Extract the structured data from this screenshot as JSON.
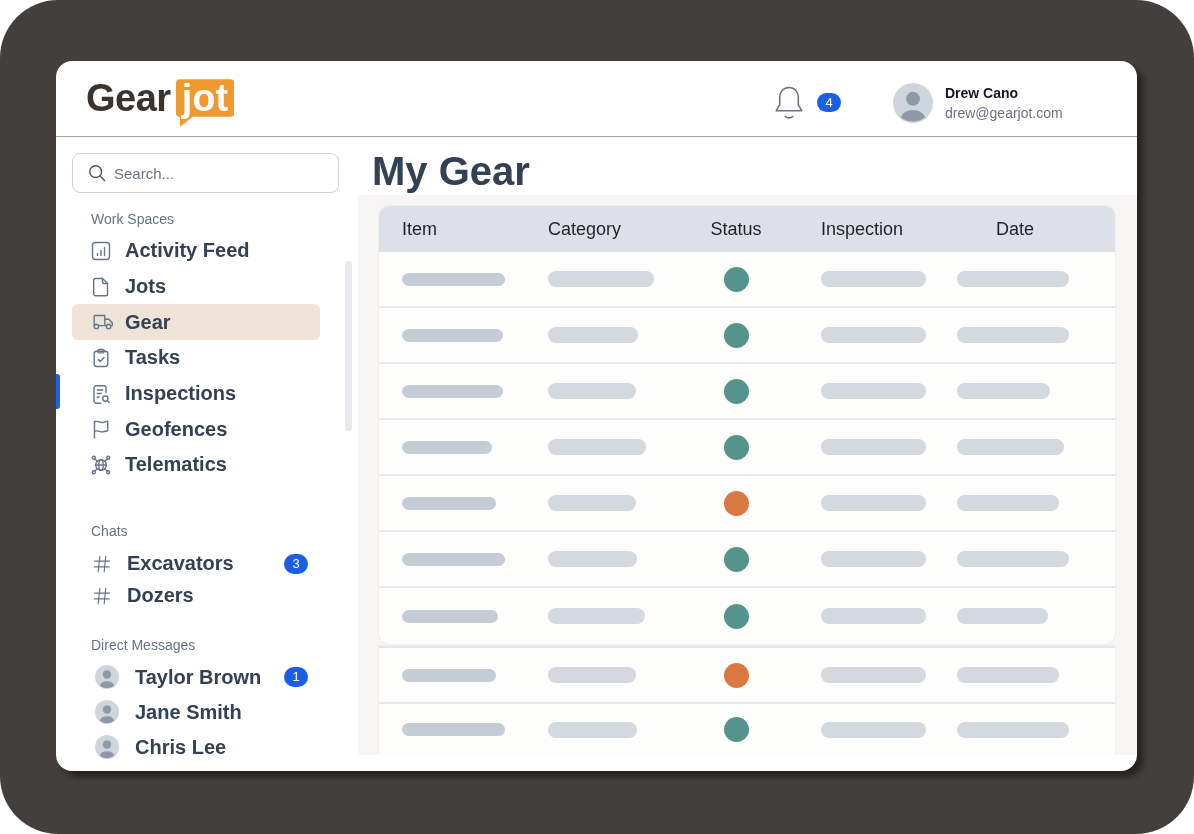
{
  "header": {
    "logo": {
      "wordmark": "Gear",
      "badge": "jot"
    },
    "notifications": {
      "count": "4"
    },
    "user": {
      "name": "Drew Cano",
      "email": "drew@gearjot.com"
    }
  },
  "sidebar": {
    "search": {
      "placeholder": "Search..."
    },
    "sections": [
      {
        "kind": "nav",
        "title": "Work Spaces",
        "items": [
          {
            "label": "Activity Feed",
            "selected": false
          },
          {
            "label": "Jots",
            "selected": false
          },
          {
            "label": "Gear",
            "selected": true
          },
          {
            "label": "Tasks",
            "selected": false
          },
          {
            "label": "Inspections",
            "selected": false
          },
          {
            "label": "Geofences",
            "selected": false
          },
          {
            "label": "Telematics",
            "selected": false
          }
        ]
      },
      {
        "kind": "channel",
        "title": "Chats",
        "items": [
          {
            "label": "Excavators",
            "badge": "3",
            "selected": false
          },
          {
            "label": "Dozers",
            "selected": false
          }
        ]
      },
      {
        "kind": "person",
        "title": "Direct Messages",
        "items": [
          {
            "label": "Taylor Brown",
            "badge": "1",
            "selected": false
          },
          {
            "label": "Jane Smith",
            "selected": false
          },
          {
            "label": "Chris Lee",
            "selected": false
          }
        ]
      }
    ]
  },
  "main": {
    "title": "My Gear",
    "table": {
      "columns": [
        "Item",
        "Category",
        "Status",
        "Inspection",
        "Date"
      ],
      "groups": [
        {
          "rows": [
            {
              "color": "#54948a"
            },
            {
              "color": "#54948a"
            },
            {
              "color": "#54948a"
            },
            {
              "color": "#54948a"
            },
            {
              "color": "#d97840"
            },
            {
              "color": "#54948a"
            },
            {
              "color": "#54948a"
            }
          ]
        },
        {
          "rows": [
            {
              "color": "#d97840"
            },
            {
              "color": "#54948a"
            }
          ]
        }
      ]
    }
  }
}
